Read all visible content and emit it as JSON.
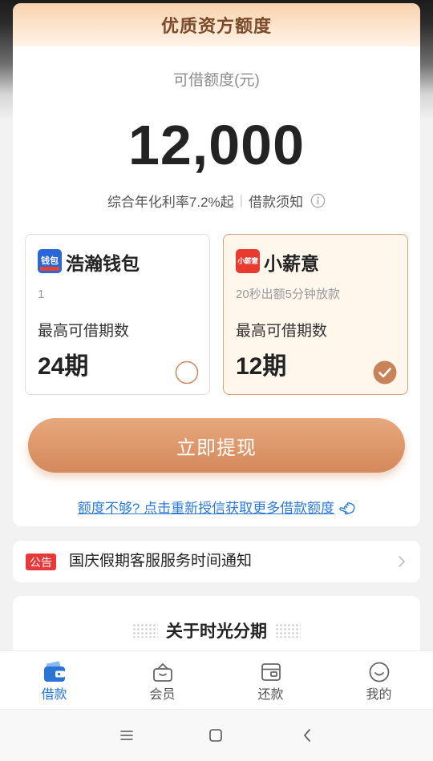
{
  "header": {
    "title": "优质资方额度"
  },
  "quota": {
    "label": "可借额度(元)",
    "amount": "12,000"
  },
  "rate": {
    "text": "综合年化利率7.2%起",
    "separator": "|",
    "notice_link": "借款须知",
    "info_icon": "info-icon"
  },
  "lenders": [
    {
      "logo_text": "钱包",
      "logo_color": "#2a66d9",
      "name": "浩瀚钱包",
      "desc": "1",
      "term_label": "最高可借期数",
      "term": "24期",
      "selected": false
    },
    {
      "logo_text": "小薪意",
      "logo_color": "#e83a2e",
      "name": "小薪意",
      "desc": "20秒出额5分钟放款",
      "term_label": "最高可借期数",
      "term": "12期",
      "selected": true
    }
  ],
  "cta": {
    "label": "立即提现"
  },
  "reauth": {
    "label": "额度不够? 点击重新授信获取更多借款额度",
    "icon": "tap-hand-icon"
  },
  "announcement": {
    "badge": "公告",
    "text": "国庆假期客服服务时间通知",
    "icon": "chevron-right-icon"
  },
  "about": {
    "title": "关于时光分期"
  },
  "tabbar": [
    {
      "label": "借款",
      "icon": "wallet-icon",
      "active": true
    },
    {
      "label": "会员",
      "icon": "member-icon",
      "active": false
    },
    {
      "label": "还款",
      "icon": "repay-card-icon",
      "active": false
    },
    {
      "label": "我的",
      "icon": "profile-smile-icon",
      "active": false
    }
  ],
  "system_nav": {
    "icons": [
      "menu-icon",
      "home-square-icon",
      "back-icon"
    ]
  },
  "colors": {
    "accent": "#d4895a",
    "accent_light": "#fff6ec",
    "link": "#2d7bd6",
    "tab_active": "#2a74d8",
    "badge": "#e6393a",
    "header_text": "#7b4a2b"
  }
}
